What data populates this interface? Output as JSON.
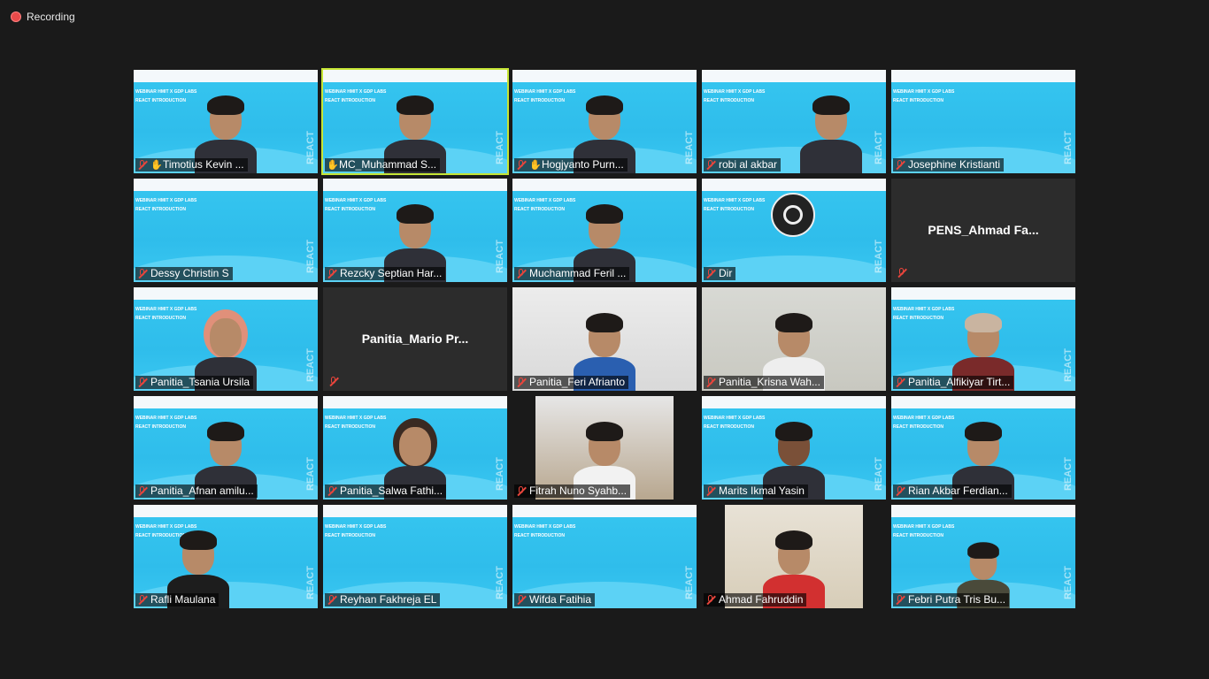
{
  "recording": {
    "label": "Recording",
    "dot_color": "#e84a4a"
  },
  "slide": {
    "heading_1": "WEBINAR HMIT X GDP LABS",
    "heading_2": "REACT INTRODUCTION",
    "side_text": "REACT"
  },
  "participants": [
    {
      "name": "Timotius Kevin ...",
      "muted": true,
      "hand": true,
      "kind": "slide"
    },
    {
      "name": "MC_Muhammad S...",
      "muted": false,
      "hand": true,
      "kind": "slide",
      "active": true
    },
    {
      "name": "Hogjyanto Purn...",
      "muted": true,
      "hand": true,
      "kind": "slide"
    },
    {
      "name": "robi al akbar",
      "muted": true,
      "hand": false,
      "kind": "slide"
    },
    {
      "name": "Josephine Kristianti",
      "muted": true,
      "hand": false,
      "kind": "slide"
    },
    {
      "name": "Dessy Christin S",
      "muted": true,
      "hand": false,
      "kind": "slide"
    },
    {
      "name": "Rezcky Septian Har...",
      "muted": true,
      "hand": false,
      "kind": "slide"
    },
    {
      "name": "Muchammad Feril ...",
      "muted": true,
      "hand": false,
      "kind": "slide"
    },
    {
      "name": "Dir",
      "muted": true,
      "hand": false,
      "kind": "obs"
    },
    {
      "name": "PENS_Ahmad  Fa...",
      "muted": true,
      "hand": false,
      "kind": "nocam"
    },
    {
      "name": "Panitia_Tsania Ursila",
      "muted": true,
      "hand": false,
      "kind": "slide"
    },
    {
      "name": "Panitia_Mario  Pr...",
      "muted": true,
      "hand": false,
      "kind": "nocam"
    },
    {
      "name": "Panitia_Feri Afrianto",
      "muted": true,
      "hand": false,
      "kind": "cam-wall"
    },
    {
      "name": "Panitia_Krisna Wah...",
      "muted": true,
      "hand": false,
      "kind": "cam-light"
    },
    {
      "name": "Panitia_Alfikiyar Tirt...",
      "muted": true,
      "hand": false,
      "kind": "slide"
    },
    {
      "name": "Panitia_Afnan amilu...",
      "muted": true,
      "hand": false,
      "kind": "slide"
    },
    {
      "name": "Panitia_Salwa Fathi...",
      "muted": true,
      "hand": false,
      "kind": "slide"
    },
    {
      "name": "Fitrah Nuno Syahb...",
      "muted": true,
      "hand": false,
      "kind": "cam-narrow"
    },
    {
      "name": "Marits Ikmal Yasin",
      "muted": true,
      "hand": false,
      "kind": "slide"
    },
    {
      "name": "Rian Akbar Ferdian...",
      "muted": true,
      "hand": false,
      "kind": "slide"
    },
    {
      "name": "Rafli Maulana",
      "muted": true,
      "hand": false,
      "kind": "slide"
    },
    {
      "name": "Reyhan Fakhreja EL",
      "muted": true,
      "hand": false,
      "kind": "slide"
    },
    {
      "name": "Wifda Fatihia",
      "muted": true,
      "hand": false,
      "kind": "slide"
    },
    {
      "name": "Ahmad Fahruddin",
      "muted": true,
      "hand": false,
      "kind": "cam-narrow"
    },
    {
      "name": "Febri Putra Tris Bu...",
      "muted": true,
      "hand": false,
      "kind": "slide"
    }
  ]
}
